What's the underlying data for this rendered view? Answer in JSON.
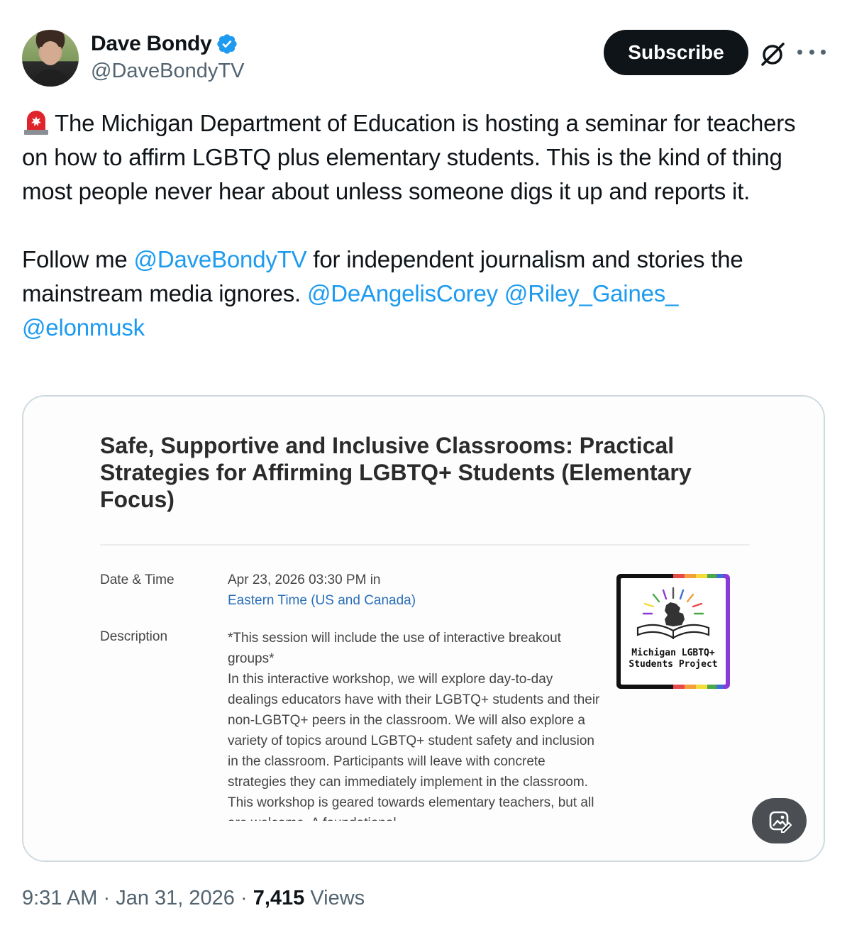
{
  "author": {
    "display_name": "Dave Bondy",
    "handle": "@DaveBondyTV",
    "verified": true,
    "avatar": "avatar-photo"
  },
  "header_actions": {
    "subscribe_label": "Subscribe",
    "grok_icon": "grok-icon",
    "more_icon": "more-icon"
  },
  "tweet": {
    "emoji": "police-light-icon",
    "paragraph1": "The Michigan Department of Education is hosting a seminar for teachers on how to affirm LGBTQ plus elementary students. This is the kind of thing most people never hear about unless someone digs it up and reports it.",
    "p2_prefix": "Follow me ",
    "mention1": "@DaveBondyTV",
    "p2_middle": " for independent journalism and stories the mainstream media ignores. ",
    "mention2": "@DeAngelisCorey",
    "mention3": "@Riley_Gaines_",
    "mention4": "@elonmusk"
  },
  "media": {
    "title": "Safe, Supportive and Inclusive Classrooms: Practical Strategies for Affirming LGBTQ+ Students (Elementary Focus)",
    "date_label": "Date & Time",
    "date_value": "Apr 23, 2026 03:30 PM  in",
    "timezone_link": "Eastern Time (US and Canada)",
    "description_label": "Description",
    "description_line1": "*This session will include the use of interactive breakout groups*",
    "description_line2": "In this interactive workshop, we will explore day-to-day dealings educators have with their LGBTQ+ students and their non-LGBTQ+ peers in the classroom. We will also explore a variety of topics around LGBTQ+ student safety and inclusion in the classroom. Participants will leave with concrete strategies they can immediately implement in the classroom. This workshop is geared towards elementary teachers, but all are welcome. A foundational",
    "logo_text_line1": "Michigan LGBTQ+",
    "logo_text_line2": "Students Project",
    "alt_icon": "image-description-icon"
  },
  "meta": {
    "time": "9:31 AM",
    "separator": "·",
    "date": "Jan 31, 2026",
    "views_count": "7,415",
    "views_label": "Views"
  },
  "colors": {
    "link": "#1d9bf0",
    "text": "#0f1419",
    "secondary": "#536471",
    "verified": "#1d9bf0"
  }
}
